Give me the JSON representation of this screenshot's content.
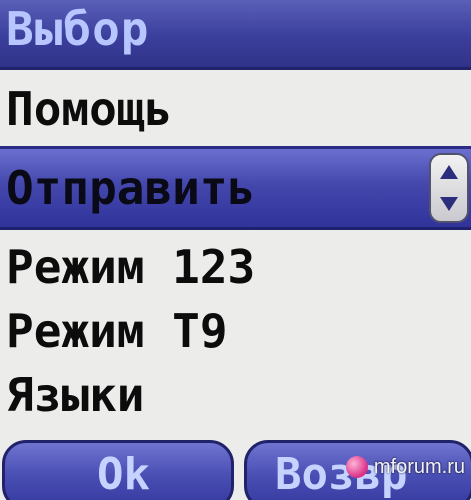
{
  "title": "Выбор",
  "menu": {
    "items": [
      {
        "label": "Помощь"
      },
      {
        "label": "Отправить",
        "selected": true
      },
      {
        "label": "Режим 123"
      },
      {
        "label": "Режим T9"
      },
      {
        "label": "Языки"
      }
    ]
  },
  "softkeys": {
    "left": "Ok",
    "right": "Возвр"
  },
  "watermark": {
    "text": "mforum.ru"
  },
  "colors": {
    "title_bar": "#3b3f9c",
    "highlight": "#4448ad",
    "background": "#ececea",
    "title_text": "#b7c6ff"
  },
  "icons": {
    "scroll": "up-down-arrows-icon"
  }
}
